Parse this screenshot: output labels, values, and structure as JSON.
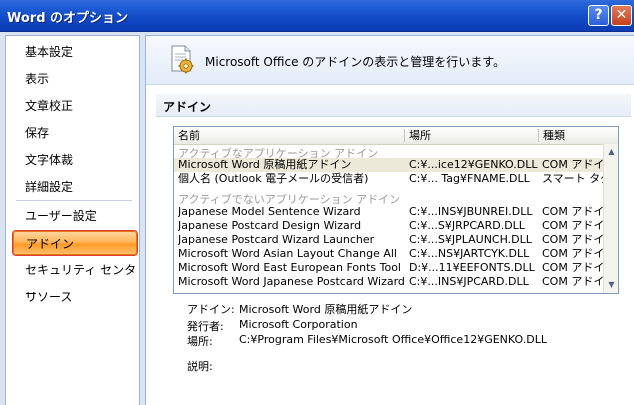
{
  "window": {
    "title": "Word のオプション",
    "help_label": "?",
    "close_label": "✕"
  },
  "nav": {
    "items": [
      {
        "label": "基本設定"
      },
      {
        "label": "表示"
      },
      {
        "label": "文章校正"
      },
      {
        "label": "保存"
      },
      {
        "label": "文字体裁"
      },
      {
        "label": "詳細設定"
      },
      {
        "label": "ユーザー設定"
      },
      {
        "label": "アドイン",
        "selected": true
      },
      {
        "label": "セキュリティ センター"
      },
      {
        "label": "リソース"
      }
    ]
  },
  "header": {
    "icon": "addin-gear-icon",
    "text": "Microsoft Office のアドインの表示と管理を行います。"
  },
  "section": {
    "title": "アドイン"
  },
  "list": {
    "columns": [
      "名前",
      "場所",
      "種類"
    ],
    "groups": [
      {
        "title": "アクティブなアプリケーション アドイン",
        "rows": [
          {
            "name": "Microsoft Word 原稿用紙アドイン",
            "location": "C:¥...ice12¥GENKO.DLL",
            "type": "COM アドイン"
          },
          {
            "name": "個人名 (Outlook 電子メールの受信者)",
            "location": "C:¥... Tag¥FNAME.DLL",
            "type": "スマート タグ"
          }
        ]
      },
      {
        "title": "アクティブでないアプリケーション アドイン",
        "rows": [
          {
            "name": "Japanese Model Sentence Wizard",
            "location": "C:¥...INS¥JBUNREI.DLL",
            "type": "COM アドイン"
          },
          {
            "name": "Japanese Postcard Design Wizard",
            "location": "C:¥...S¥JRPCARD.DLL",
            "type": "COM アドイン"
          },
          {
            "name": "Japanese Postcard Wizard Launcher",
            "location": "C:¥...S¥JPLAUNCH.DLL",
            "type": "COM アドイン"
          },
          {
            "name": "Microsoft Word Asian Layout Change All",
            "location": "C:¥...NS¥JARTCYK.DLL",
            "type": "COM アドイン"
          },
          {
            "name": "Microsoft Word East European Fonts Tool",
            "location": "D:¥...11¥EEFONTS.DLL",
            "type": "COM アドイン"
          },
          {
            "name": "Microsoft Word Japanese Postcard Wizard",
            "location": "C:¥...INS¥JPCARD.DLL",
            "type": "COM アドイン"
          }
        ]
      }
    ]
  },
  "detail": {
    "addin_label": "アドイン:",
    "addin_value": "Microsoft Word 原稿用紙アドイン",
    "publisher_label": "発行者:",
    "publisher_value": "Microsoft Corporation",
    "location_label": "場所:",
    "location_value": "C:¥Program Files¥Microsoft Office¥Office12¥GENKO.DLL",
    "description_label": "説明:"
  },
  "colors": {
    "title_bar": "#0f45c0",
    "selected_nav": "#ffb65a",
    "selected_outline": "#e23b2b",
    "group_header": "#9a9a9a"
  }
}
